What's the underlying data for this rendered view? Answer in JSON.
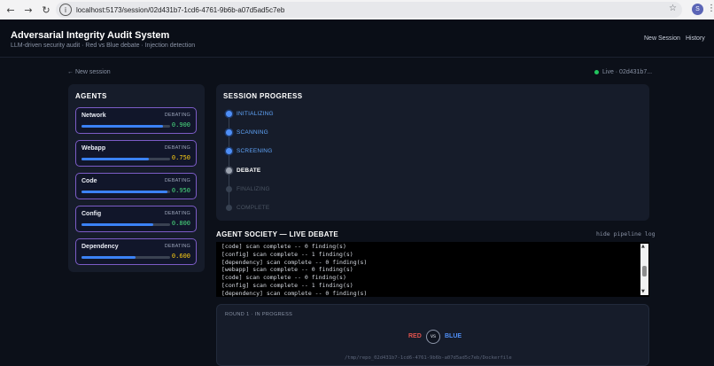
{
  "browser": {
    "url": "localhost:5173/session/02d431b7-1cd6-4761-9b6b-a07d5ad5c7eb",
    "profile_initial": "S"
  },
  "header": {
    "title": "Adversarial Integrity Audit System",
    "subtitle": "LLM-driven security audit · Red vs Blue debate · Injection detection",
    "new_session": "New Session",
    "history": "History"
  },
  "subheader": {
    "back_link": "← New session",
    "live_status": "Live · 02d431b7..."
  },
  "agents": {
    "title": "AGENTS",
    "items": [
      {
        "name": "Network",
        "status": "DEBATING",
        "score": "0.900",
        "progress": 0.92,
        "score_color": "#4ade80"
      },
      {
        "name": "Webapp",
        "status": "DEBATING",
        "score": "0.750",
        "progress": 0.76,
        "score_color": "#facc15"
      },
      {
        "name": "Code",
        "status": "DEBATING",
        "score": "0.950",
        "progress": 0.97,
        "score_color": "#4ade80"
      },
      {
        "name": "Config",
        "status": "DEBATING",
        "score": "0.800",
        "progress": 0.81,
        "score_color": "#4ade80"
      },
      {
        "name": "Dependency",
        "status": "DEBATING",
        "score": "0.600",
        "progress": 0.61,
        "score_color": "#facc15"
      }
    ]
  },
  "progress": {
    "title": "SESSION PROGRESS",
    "steps": [
      {
        "label": "INITIALIZING",
        "state": "done"
      },
      {
        "label": "SCANNING",
        "state": "done"
      },
      {
        "label": "SCREENING",
        "state": "done"
      },
      {
        "label": "DEBATE",
        "state": "active"
      },
      {
        "label": "FINALIZING",
        "state": "pending"
      },
      {
        "label": "COMPLETE",
        "state": "pending"
      }
    ]
  },
  "debate": {
    "title": "AGENT SOCIETY — LIVE DEBATE",
    "hide_log": "hide pipeline log",
    "log": [
      "[code] scan complete -- 0 finding(s)",
      "[config] scan complete -- 1 finding(s)",
      "[dependency] scan complete -- 0 finding(s)",
      "[webapp] scan complete -- 0 finding(s)",
      "[code] scan complete -- 0 finding(s)",
      "[config] scan complete -- 1 finding(s)",
      "[dependency] scan complete -- 0 finding(s)"
    ]
  },
  "round": {
    "label": "ROUND 1 · IN PROGRESS",
    "red": "RED",
    "vs": "vs",
    "blue": "BLUE",
    "file_path": "/tmp/repo_02d431b7-1cd6-4761-9b6b-a07d5ad5c7eb/Dockerfile"
  },
  "colors": {
    "accent_blue": "#3b82f6",
    "done_text": "#60a5fa",
    "active_text": "#ffffff",
    "pending_text": "#4b5563"
  }
}
